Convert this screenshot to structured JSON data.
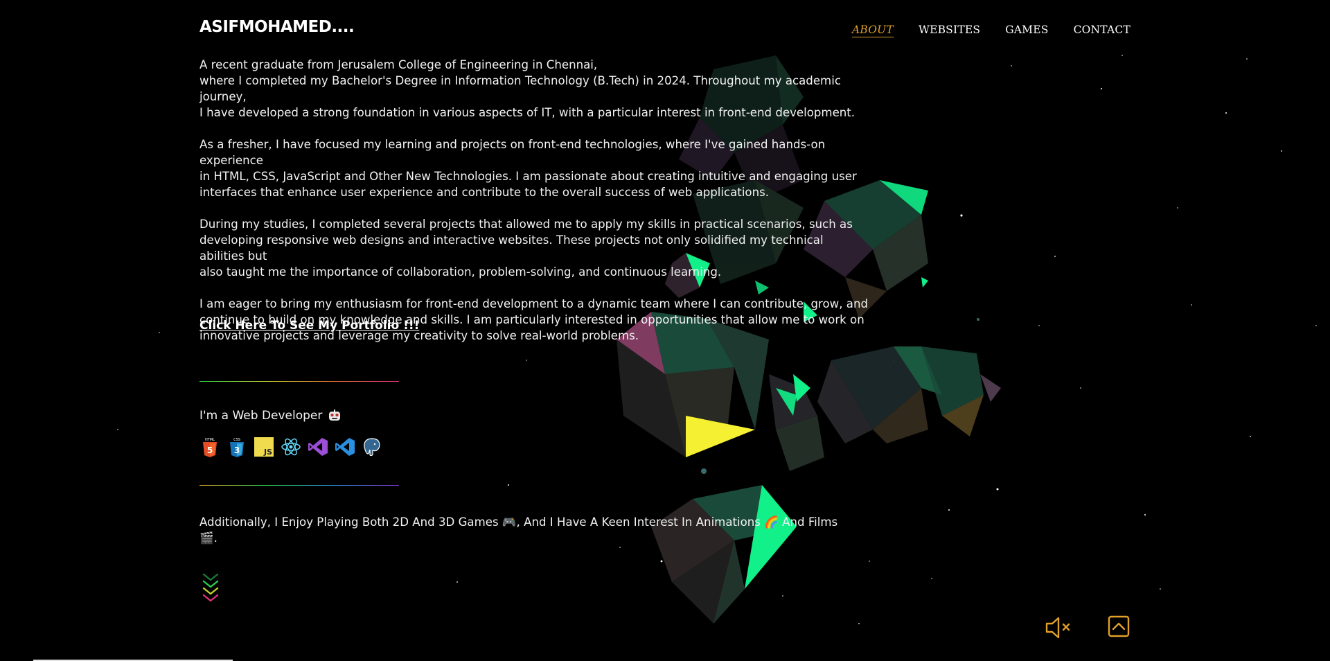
{
  "header": {
    "logo": "ASIFMOHAMED....",
    "nav": [
      "ABOUT",
      "WEBSITES",
      "GAMES",
      "CONTACT"
    ],
    "active": "ABOUT"
  },
  "about": {
    "p1": [
      "A recent graduate from Jerusalem College of Engineering in Chennai,",
      "where I completed my Bachelor's Degree in Information Technology (B.Tech) in 2024. Throughout my academic journey,",
      "I have developed a strong foundation in various aspects of IT, with a particular interest in front-end development."
    ],
    "p2": [
      "As a fresher, I have focused my learning and projects on front-end technologies, where I've gained hands-on experience",
      "in HTML, CSS, JavaScript and Other New Technologies. I am passionate about creating intuitive and engaging user",
      "interfaces that enhance user experience and contribute to the overall success of web applications."
    ],
    "p3": [
      "During my studies, I completed several projects that allowed me to apply my skills in practical scenarios, such as",
      "developing responsive web designs and interactive websites. These projects not only solidified my technical abilities but",
      "also taught me the importance of collaboration, problem-solving, and continuous learning."
    ],
    "p4": [
      "I am eager to bring my enthusiasm for front-end development to a dynamic team where I can contribute, grow, and",
      "continue to build on my knowledge and skills. I am particularly interested in opportunities that allow me to work on",
      "innovative projects and leverage my creativity to solve real-world problems."
    ]
  },
  "portfolio_link": "Click Here To See My Portfolio !!!",
  "developer": {
    "label": "I'm a Web Developer",
    "icons": [
      "html5-icon",
      "css3-icon",
      "javascript-icon",
      "react-icon",
      "visual-studio-icon",
      "vscode-icon",
      "postgresql-icon"
    ]
  },
  "hobby": {
    "line1": "Additionally, I Enjoy Playing Both 2D And 3D Games 🎮, And I Have A Keen Interest In Animations 🌈 And Films",
    "line2": "🎬."
  },
  "colors": {
    "accent": "#e0a02a",
    "background": "#000000",
    "text": "#ffffff",
    "crystal_green": "#12f08a",
    "crystal_yellow": "#f5f032",
    "crystal_pink": "#a04a78"
  }
}
